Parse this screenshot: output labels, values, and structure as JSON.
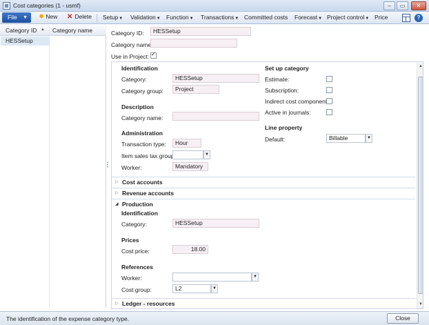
{
  "window": {
    "title": "Cost categories (1 - usmf)",
    "controls": [
      "–",
      "▭",
      "✕"
    ]
  },
  "toolbar": {
    "file_label": "File",
    "new_label": "New",
    "delete_label": "Delete",
    "menus": [
      "Setup",
      "Validation",
      "Function",
      "Transactions",
      "Committed costs",
      "Forecast",
      "Project control",
      "Price"
    ]
  },
  "list": {
    "columns": [
      "Category ID",
      "Category name"
    ],
    "rows": [
      {
        "id": "HESSetup",
        "name": ""
      }
    ]
  },
  "header": {
    "category_id_label": "Category ID:",
    "category_id_value": "HESSetup",
    "category_name_label": "Category name:",
    "category_name_value": "",
    "use_in_project_label": "Use in Project:",
    "use_in_project_checked": true
  },
  "general": {
    "identification": {
      "title": "Identification",
      "category_label": "Category:",
      "category_value": "HESSetup",
      "category_group_label": "Category group:",
      "category_group_value": "Project"
    },
    "description": {
      "title": "Description",
      "category_name_label": "Category name:",
      "category_name_value": ""
    },
    "administration": {
      "title": "Administration",
      "transaction_type_label": "Transaction type:",
      "transaction_type_value": "Hour",
      "item_sales_tax_group_label": "Item sales tax group:",
      "item_sales_tax_group_value": "",
      "worker_label": "Worker:",
      "worker_value": "Mandatory"
    },
    "set_up_category": {
      "title": "Set up category",
      "estimate_label": "Estimate:",
      "subscription_label": "Subscription:",
      "indirect_cost_component_label": "Indirect cost component:",
      "active_in_journals_label": "Active in journals:"
    },
    "line_property": {
      "title": "Line property",
      "default_label": "Default:",
      "default_value": "Billable"
    }
  },
  "fast_tabs": {
    "cost_accounts": "Cost accounts",
    "revenue_accounts": "Revenue accounts",
    "production": "Production",
    "ledger_resources": "Ledger - resources"
  },
  "production": {
    "identification_title": "Identification",
    "category_label": "Category:",
    "category_value": "HESSetup",
    "prices_title": "Prices",
    "cost_price_label": "Cost price:",
    "cost_price_value": "18.00",
    "references_title": "References",
    "worker_label": "Worker:",
    "worker_value": "",
    "cost_group_label": "Cost group:",
    "cost_group_value": "L2"
  },
  "status": {
    "text": "The identification of the expense category type.",
    "close_label": "Close"
  }
}
